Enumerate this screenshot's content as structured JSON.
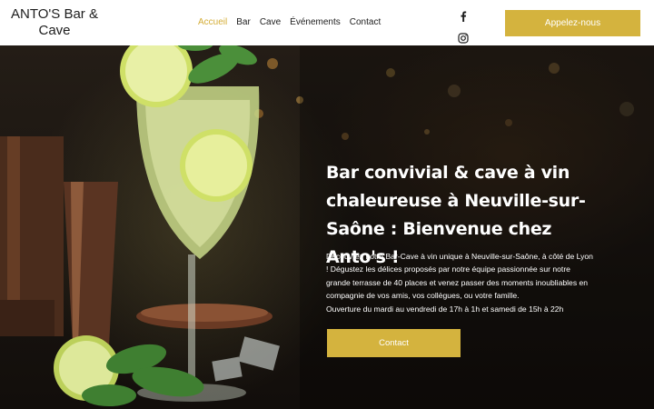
{
  "brand": {
    "name": "ANTO'S Bar & Cave"
  },
  "nav": {
    "items": [
      {
        "label": "Accueil",
        "active": true
      },
      {
        "label": "Bar",
        "active": false
      },
      {
        "label": "Cave",
        "active": false
      },
      {
        "label": "Événements",
        "active": false
      },
      {
        "label": "Contact",
        "active": false
      }
    ]
  },
  "social": {
    "icons": [
      "facebook-icon",
      "instagram-icon"
    ]
  },
  "header_cta": {
    "label": "Appelez-nous"
  },
  "hero": {
    "title": "Bar convivial & cave à vin chaleureuse à Neuville-sur-Saône : Bienvenue chez Anto's !",
    "description": "Découvrez notre Bar-Cave à vin unique à Neuville-sur-Saône, à côté de Lyon ! Dégustez les délices proposés par notre équipe passionnée sur notre grande terrasse de 40 places et venez passer des moments inoubliables en compagnie de vos amis, vos collègues, ou votre famille.",
    "hours": "Ouverture du mardi au vendredi de 17h à 1h et samedi de 15h à 22h",
    "cta_label": "Contact"
  },
  "colors": {
    "accent": "#d4b33e",
    "active_nav": "#d4ad37",
    "header_bg": "#ffffff",
    "text_dark": "#1d1d1d"
  }
}
